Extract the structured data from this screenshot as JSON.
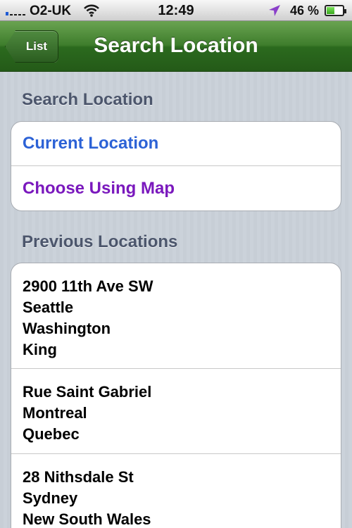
{
  "status_bar": {
    "carrier": "O2-UK",
    "time": "12:49",
    "battery": "46 %",
    "battery_level": 0.46,
    "icons": [
      "signal-icon",
      "wifi-icon",
      "location-arrow-icon",
      "battery-icon"
    ]
  },
  "navbar": {
    "back_label": "List",
    "title": "Search Location"
  },
  "search_section": {
    "header": "Search Location",
    "current_location": "Current Location",
    "choose_map": "Choose Using Map"
  },
  "previous_section": {
    "header": "Previous Locations",
    "locations": [
      {
        "lines": [
          "2900 11th Ave SW",
          "Seattle",
          "Washington",
          "King"
        ]
      },
      {
        "lines": [
          "Rue Saint Gabriel",
          "Montreal",
          "Quebec"
        ]
      },
      {
        "lines": [
          "28 Nithsdale St",
          "Sydney",
          "New South Wales"
        ]
      }
    ]
  },
  "colors": {
    "nav_green": "#3e7d2c",
    "current_location_blue": "#2c62d6",
    "choose_map_purple": "#7a18bd",
    "section_header": "#4c566c"
  }
}
